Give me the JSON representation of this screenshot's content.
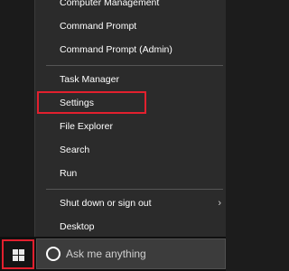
{
  "menu": {
    "items": [
      {
        "label": "Computer Management"
      },
      {
        "label": "Command Prompt"
      },
      {
        "label": "Command Prompt (Admin)"
      },
      {
        "label": "Task Manager"
      },
      {
        "label": "Settings"
      },
      {
        "label": "File Explorer"
      },
      {
        "label": "Search"
      },
      {
        "label": "Run"
      },
      {
        "label": "Shut down or sign out"
      },
      {
        "label": "Desktop"
      }
    ],
    "submenu_arrow": "›"
  },
  "taskbar": {
    "start_icon": "windows-logo-icon",
    "search_icon": "cortana-circle-icon",
    "search_placeholder": "Ask me anything"
  },
  "colors": {
    "highlight_border": "#e2202e",
    "menu_bg": "#2b2b2b",
    "taskbar_bg": "#101010"
  }
}
